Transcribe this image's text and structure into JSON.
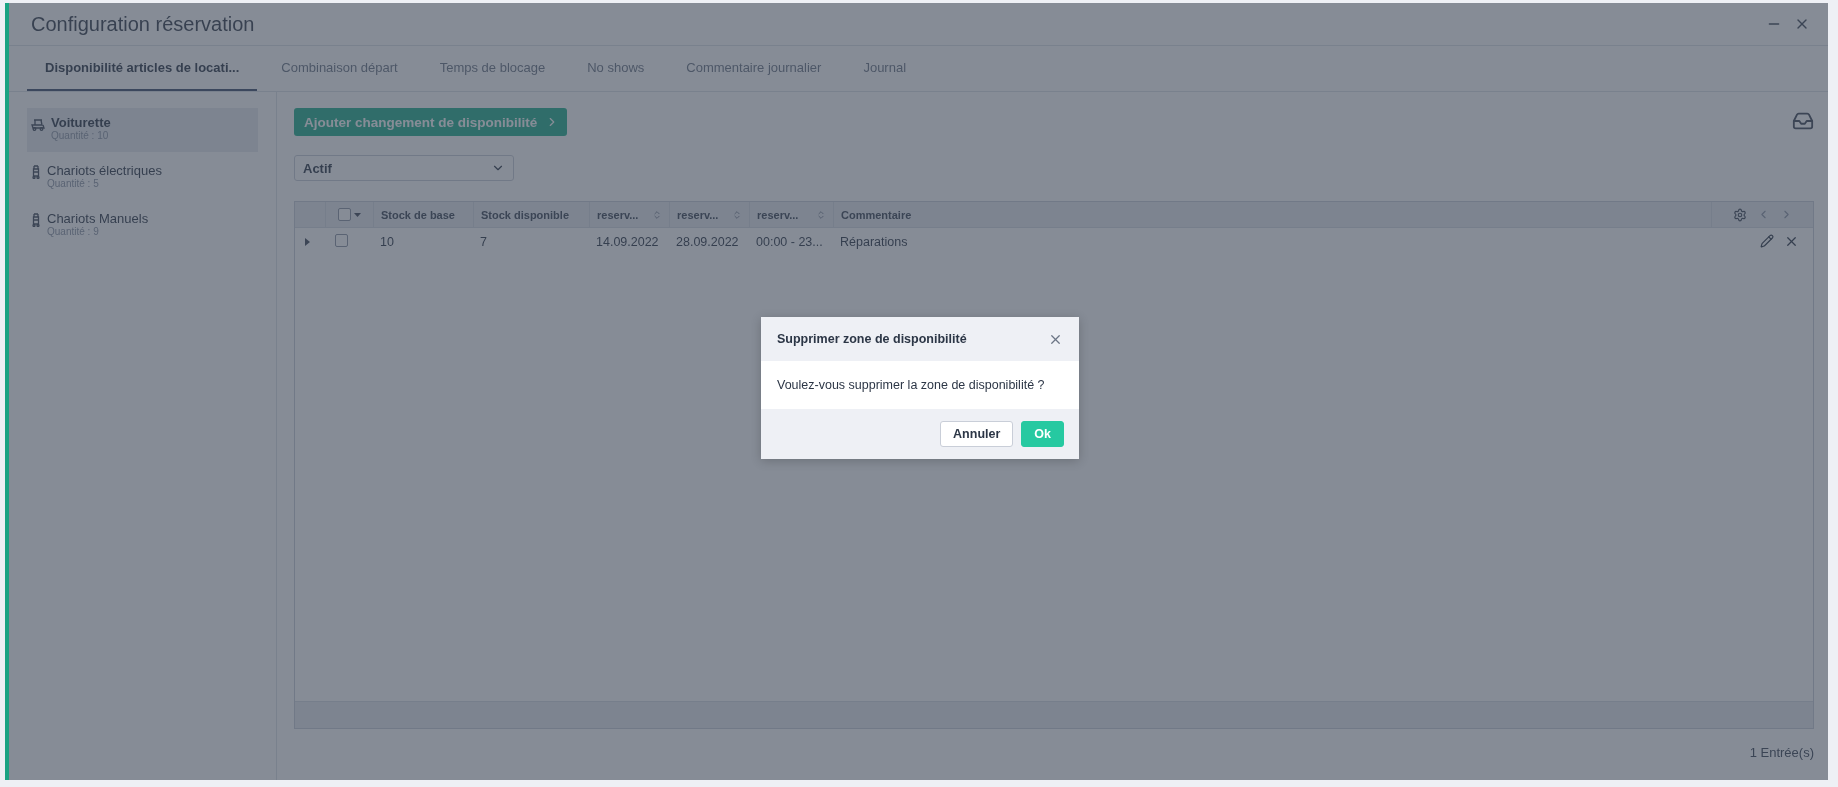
{
  "window": {
    "title": "Configuration réservation"
  },
  "tabs": [
    {
      "label": "Disponibilité articles de locati...",
      "selected": true
    },
    {
      "label": "Combinaison départ",
      "selected": false
    },
    {
      "label": "Temps de blocage",
      "selected": false
    },
    {
      "label": "No shows",
      "selected": false
    },
    {
      "label": "Commentaire journalier",
      "selected": false
    },
    {
      "label": "Journal",
      "selected": false
    }
  ],
  "sidebar": {
    "items": [
      {
        "name": "Voiturette",
        "quantity": "Quantité : 10",
        "kind": "cart",
        "selected": true
      },
      {
        "name": "Chariots électriques",
        "quantity": "Quantité : 5",
        "kind": "trolley",
        "selected": false
      },
      {
        "name": "Chariots Manuels",
        "quantity": "Quantité : 9",
        "kind": "trolley",
        "selected": false
      }
    ]
  },
  "add_button": {
    "label": "Ajouter changement de disponibilité"
  },
  "filter": {
    "value": "Actif"
  },
  "table": {
    "select_all_checked": false,
    "columns": [
      {
        "label": "Stock de base",
        "sortable": false
      },
      {
        "label": "Stock disponible",
        "sortable": false
      },
      {
        "label": "reserv...",
        "sortable": true
      },
      {
        "label": "reserv...",
        "sortable": true
      },
      {
        "label": "reserv...",
        "sortable": true
      },
      {
        "label": "Commentaire",
        "sortable": false
      }
    ],
    "rows": [
      {
        "checked": false,
        "expanded": false,
        "cells": [
          "10",
          "7",
          "14.09.2022",
          "28.09.2022",
          "00:00 - 23...",
          "Réparations"
        ]
      }
    ],
    "count": "1 Entrée(s)"
  },
  "dialog": {
    "title": "Supprimer zone de disponibilité",
    "message": "Voulez-vous supprimer la zone de disponibilité ?",
    "buttons": [
      {
        "label": "Annuler",
        "kind": "secondary"
      },
      {
        "label": "Ok",
        "kind": "primary"
      }
    ]
  }
}
